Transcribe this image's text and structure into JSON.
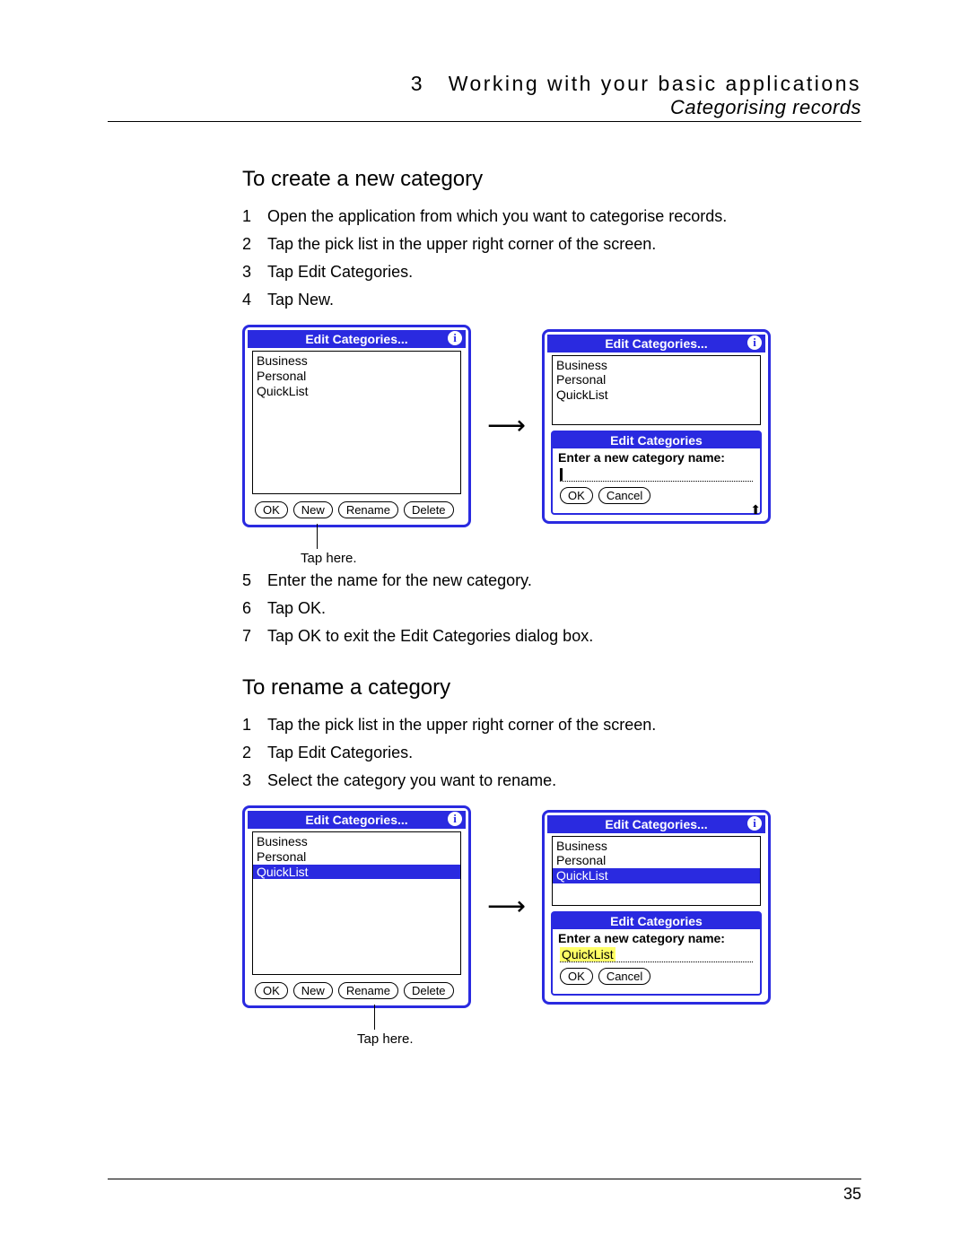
{
  "header": {
    "chapter_number": "3",
    "chapter_title": "Working with your basic applications",
    "subtitle": "Categorising records"
  },
  "sectionA": {
    "heading": "To create a new category",
    "steps1": [
      "Open the application from which you want to categorise records.",
      "Tap the pick list in the upper right corner of the screen.",
      "Tap Edit Categories.",
      "Tap New."
    ],
    "steps2": [
      "Enter the name for the new category.",
      "Tap OK.",
      "Tap OK to exit the Edit Categories dialog box."
    ]
  },
  "sectionB": {
    "heading": "To rename a category",
    "steps": [
      "Tap the pick list in the upper right corner of the screen.",
      "Tap Edit Categories.",
      "Select the category you want to rename."
    ]
  },
  "palm": {
    "main_title": "Edit Categories...",
    "info_glyph": "i",
    "categories": [
      "Business",
      "Personal",
      "QuickList"
    ],
    "selected": "QuickList",
    "buttons_main": {
      "ok": "OK",
      "new": "New",
      "rename": "Rename",
      "delete": "Delete"
    },
    "sub_title": "Edit Categories",
    "sub_prompt": "Enter a new category name:",
    "sub_ok": "OK",
    "sub_cancel": "Cancel",
    "input_value_rename": "QuickList"
  },
  "captions": {
    "tap_here": "Tap here."
  },
  "page_number": "35"
}
